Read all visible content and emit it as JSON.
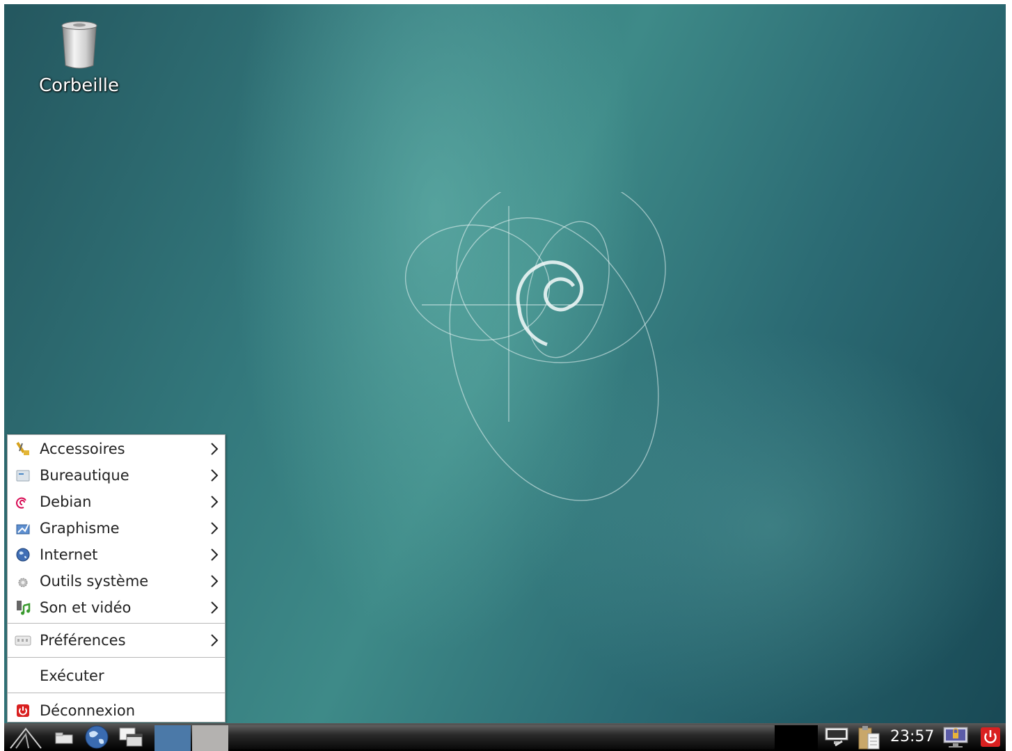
{
  "desktop": {
    "icons": [
      {
        "label": "Corbeille",
        "icon": "trash-icon"
      }
    ]
  },
  "menu": {
    "items": [
      {
        "label": "Accessoires",
        "icon": "accessories-icon",
        "submenu": true
      },
      {
        "label": "Bureautique",
        "icon": "office-icon",
        "submenu": true
      },
      {
        "label": "Debian",
        "icon": "debian-icon",
        "submenu": true
      },
      {
        "label": "Graphisme",
        "icon": "graphics-icon",
        "submenu": true
      },
      {
        "label": "Internet",
        "icon": "internet-icon",
        "submenu": true
      },
      {
        "label": "Outils système",
        "icon": "system-tools-icon",
        "submenu": true
      },
      {
        "label": "Son et vidéo",
        "icon": "multimedia-icon",
        "submenu": true
      },
      {
        "label": "Préférences",
        "icon": "preferences-icon",
        "submenu": true
      },
      {
        "label": "Exécuter",
        "icon": null,
        "submenu": false
      },
      {
        "label": "Déconnexion",
        "icon": "logout-icon",
        "submenu": false
      }
    ]
  },
  "taskbar": {
    "clock": "23:57",
    "launchers": [
      "start-menu-icon",
      "file-manager-icon",
      "web-browser-icon",
      "window-switcher-icon"
    ],
    "desktops": [
      "desktop-1",
      "desktop-2"
    ],
    "tray": [
      "network-icon",
      "clipboard-icon",
      "lock-screen-icon",
      "power-icon"
    ]
  },
  "colors": {
    "menu_bg": "#ffffff",
    "taskbar_bg": "#1f1f1f",
    "desktop_active": "#4b79a8",
    "desktop_inactive": "#b4b2b0",
    "power_red": "#d92020"
  }
}
